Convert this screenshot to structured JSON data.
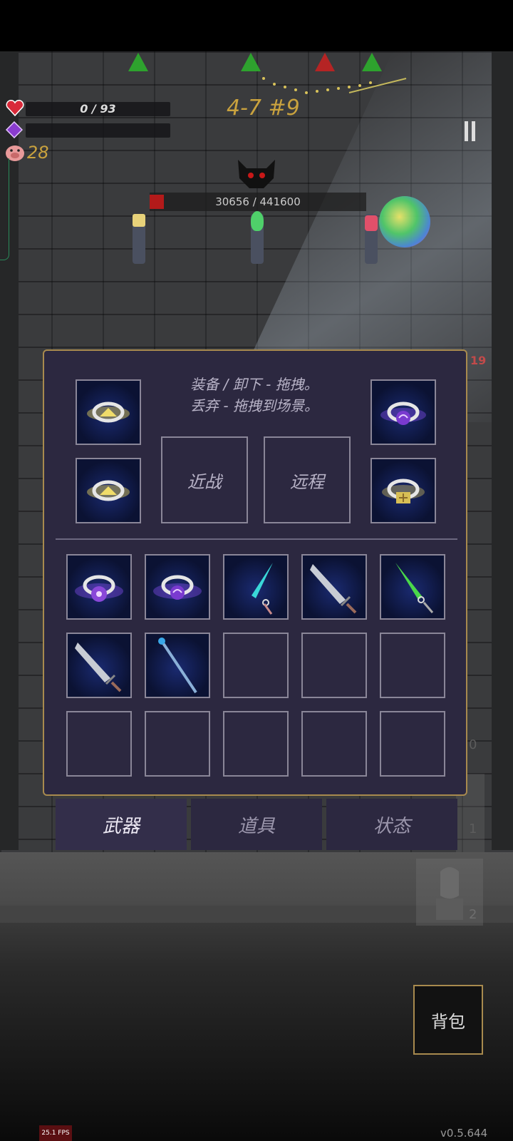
{
  "hud": {
    "hp_text": "0 / 93",
    "hp_fraction": 0,
    "mana_fraction": 0,
    "coins": "28",
    "level": "4-7 #9",
    "pause_icon": "pause-icon",
    "room_markers": [
      "green",
      "green",
      "red",
      "green"
    ]
  },
  "boss": {
    "hp_text": "30656 / 441600",
    "hp_fraction": 0.069
  },
  "side_counters": {
    "right_number": "19",
    "dim_zero": "0",
    "slot_one": "1",
    "slot_two": "2"
  },
  "inventory": {
    "hint_line1": "装备 / 卸下 - 拖拽。",
    "hint_line2": "丢弃 - 拖拽到场景。",
    "melee_label": "近战",
    "ranged_label": "远程",
    "equipped_rings": [
      "ring-gold-gem-icon",
      "ring-purple-swirl-icon",
      "ring-gold-gem-icon",
      "ring-gold-cross-icon"
    ],
    "grid": [
      [
        "ring-purple-flower-icon",
        "ring-purple-swirl-icon",
        "cyan-sword-icon",
        "grey-greatsword-icon",
        "green-sword-icon"
      ],
      [
        "grey-greatsword-icon",
        "blue-staff-icon",
        "",
        "",
        ""
      ],
      [
        "",
        "",
        "",
        "",
        ""
      ]
    ]
  },
  "tabs": {
    "weapons": "武器",
    "items": "道具",
    "status": "状态"
  },
  "bag_button": "背包",
  "fps": "25.1 FPS",
  "version": "v0.5.644",
  "colors": {
    "panel_bg": "#2c2840",
    "panel_border": "#a88a4e",
    "gold_text": "#c9a23e"
  }
}
